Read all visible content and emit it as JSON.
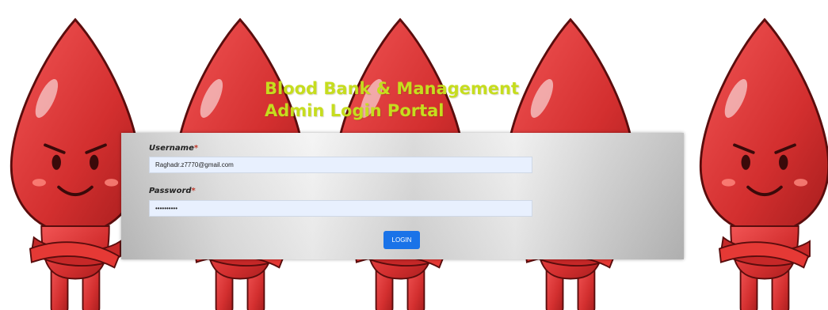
{
  "page": {
    "title_line1": "Blood Bank & Management",
    "title_line2": "Admin Login Portal"
  },
  "form": {
    "username_label": "Username",
    "password_label": "Password",
    "required_mark": "*",
    "username_value": "Raghadr.z7770@gmail.com",
    "password_value": "••••••••••",
    "login_label": "LOGIN"
  },
  "colors": {
    "title": "#c6dd1e",
    "mascot_red": "#d32f2f",
    "input_bg": "#e8f0fe",
    "button": "#1a73e8"
  },
  "icons": {
    "mascot": "blood-drop-mascot-icon"
  }
}
